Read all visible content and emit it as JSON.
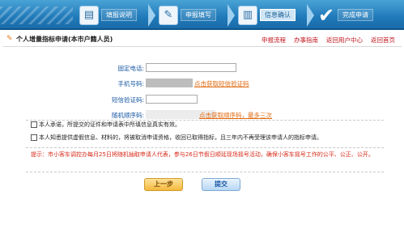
{
  "steps": [
    {
      "label": "填报说明",
      "icon": "clipboard-icon"
    },
    {
      "label": "申报填写",
      "icon": "pencil-icon"
    },
    {
      "label": "信息确认",
      "icon": "window-icon"
    },
    {
      "label": "完成申请",
      "icon": "check-icon"
    }
  ],
  "header": {
    "title": "个人增量指标申请(本市户籍人员)",
    "links": [
      "申报流程",
      "办事指南",
      "返回用户中心",
      "返回首页"
    ]
  },
  "form": {
    "landline_label": "固定电话:",
    "landline_value": "",
    "mobile_label": "手机号码:",
    "mobile_action": "点击获取短信验证码",
    "sms_code_label": "短信验证码:",
    "sms_code_value": "",
    "random_password_label": "随机顺序码:",
    "random_password_action": "点击获取顺序码，最多三次"
  },
  "checks": [
    "本人承诺，所提交的证件和申请表中所填信息真实有效。",
    "本人知悉提供虚假信息、材料的，将被取消申请资格，收回已取得指标，且三年内不再受理该申请人的指标申请。"
  ],
  "notice": "提示：市小客车调控办每月25日将随机抽取申请人代表，参与26日节假日顺延现场摇号活动，确保小客车摇号工作的公平、公正、公开。",
  "buttons": {
    "prev": "上一步",
    "submit": "提交"
  },
  "colors": {
    "banner": "#1f78b8",
    "label": "#1a58a3",
    "link": "#c0161d",
    "action": "#e06a10",
    "notice": "#d72a1a"
  }
}
